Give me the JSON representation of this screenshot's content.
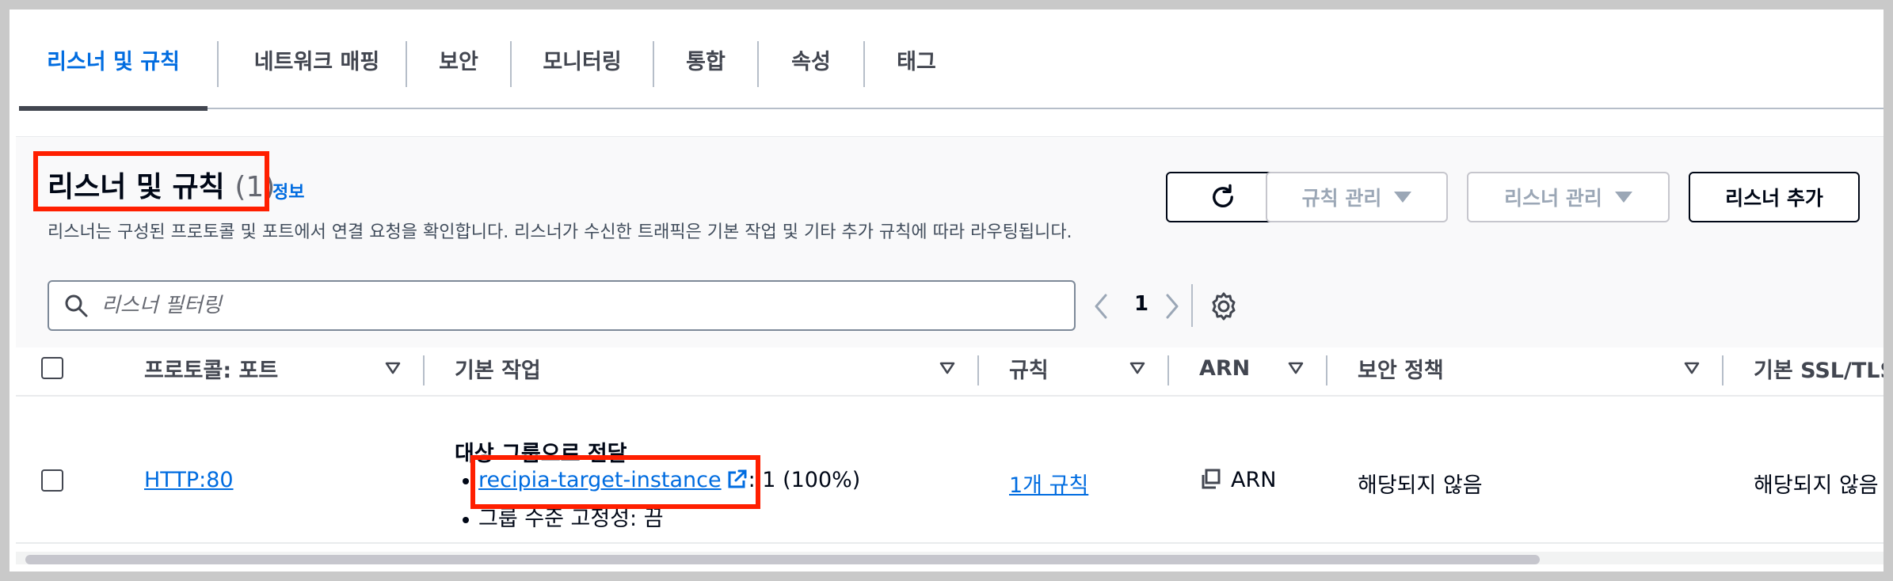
{
  "tabs": [
    {
      "label": "리스너 및 규칙",
      "active": true
    },
    {
      "label": "네트워크 매핑",
      "active": false
    },
    {
      "label": "보안",
      "active": false
    },
    {
      "label": "모니터링",
      "active": false
    },
    {
      "label": "통합",
      "active": false
    },
    {
      "label": "속성",
      "active": false
    },
    {
      "label": "태그",
      "active": false
    }
  ],
  "section": {
    "title": "리스너 및 규칙",
    "count": "(1)",
    "info_link": "정보",
    "description": "리스너는 구성된 프로토콜 및 포트에서 연결 요청을 확인합니다. 리스너가 수신한 트래픽은 기본 작업 및 기타 추가 규칙에 따라 라우팅됩니다."
  },
  "toolbar": {
    "refresh_icon": "refresh-icon",
    "manage_rules_label": "규칙 관리",
    "manage_listener_label": "리스너 관리",
    "add_listener_label": "리스너 추가"
  },
  "filter": {
    "placeholder": "리스너 필터링",
    "value": ""
  },
  "pagination": {
    "current_page": "1"
  },
  "table": {
    "columns": [
      "프로토콜: 포트",
      "기본 작업",
      "규칙",
      "ARN",
      "보안 정책",
      "기본 SSL/TLS"
    ],
    "rows": [
      {
        "protocol_port": "HTTP:80",
        "default_action_title": "대상 그룹으로 전달",
        "target_group": "recipia-target-instance",
        "target_weight": ": 1 (100%)",
        "stickiness": "그룹 수준 고정성: 끔",
        "rules": "1개 규칙",
        "arn": "ARN",
        "security_policy": "해당되지 않음",
        "default_ssl": "해당되지 않음"
      }
    ]
  },
  "colors": {
    "accent": "#006ce0",
    "highlight_box": "#ff1f00",
    "text": "#000716",
    "disabled": "#9ba7b6"
  }
}
